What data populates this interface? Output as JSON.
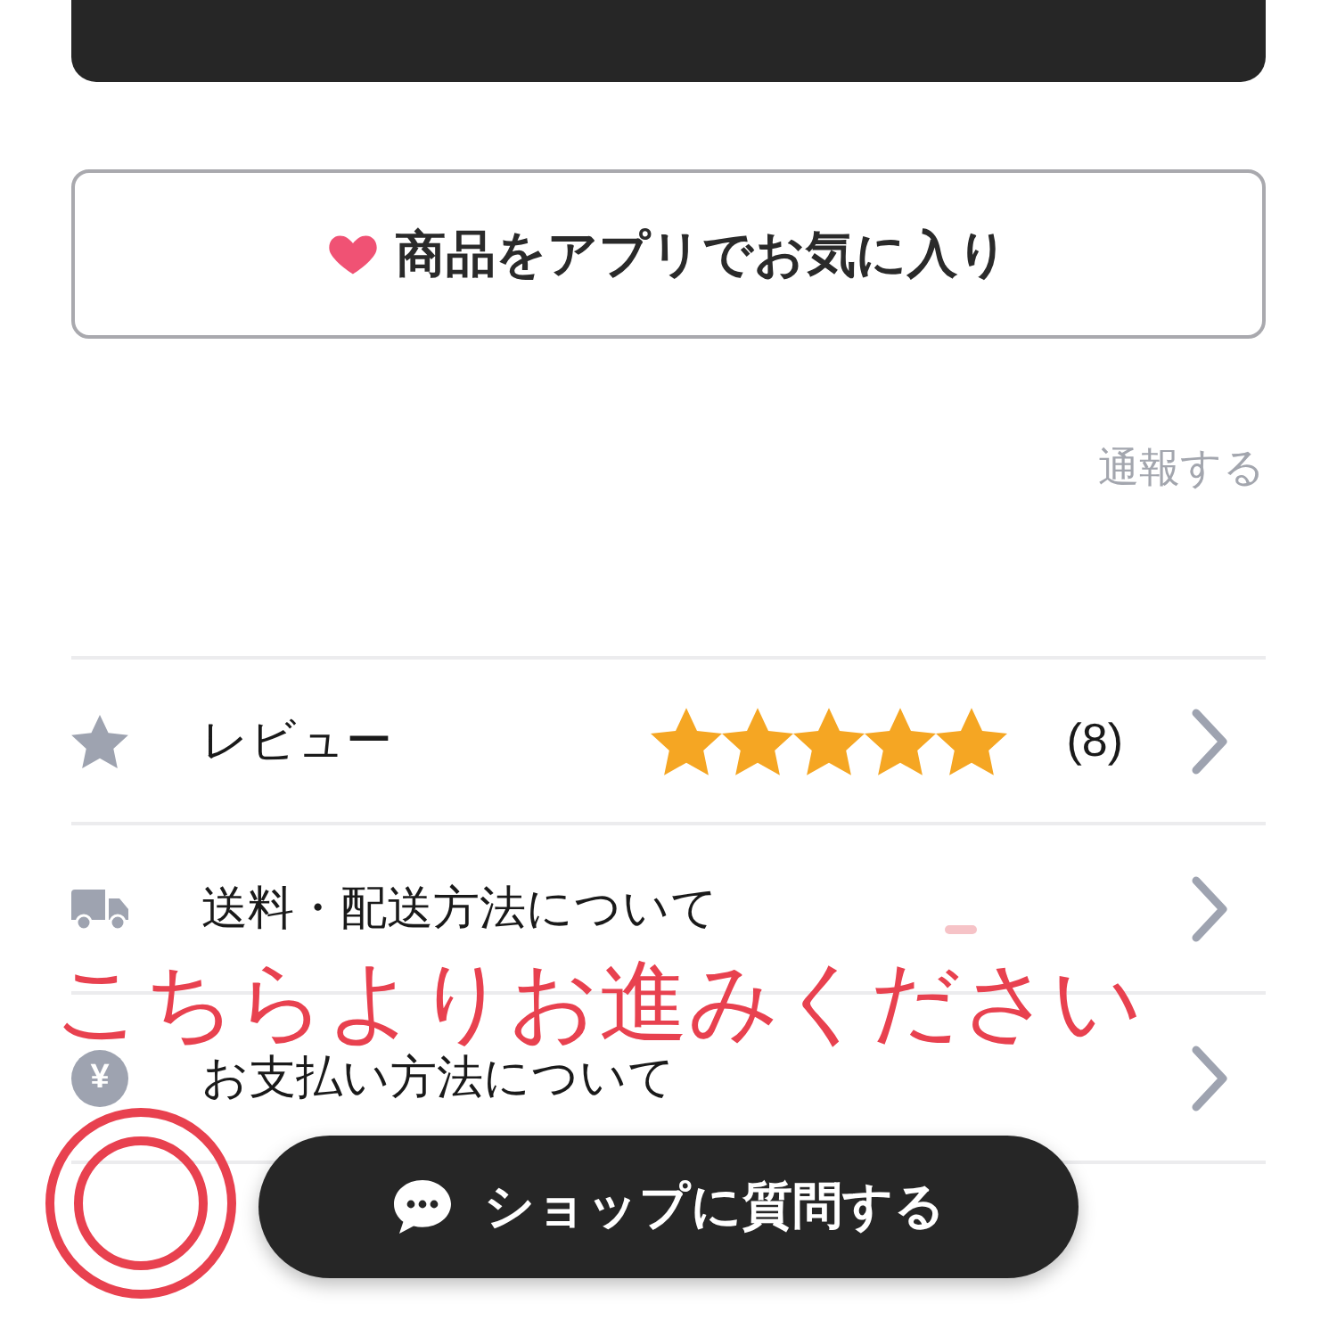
{
  "favorite_button": {
    "label": "商品をアプリでお気に入り"
  },
  "report_link": {
    "label": "通報する"
  },
  "rows": [
    {
      "kind": "review",
      "label": "レビュー",
      "stars": 5,
      "count": "(8)"
    },
    {
      "kind": "shipping",
      "label": "送料・配送方法について"
    },
    {
      "kind": "payment",
      "icon_text": "¥",
      "label": "お支払い方法について"
    }
  ],
  "annotation": {
    "text": "こちらよりお進みください"
  },
  "question_button": {
    "label": "ショップに質問する"
  }
}
